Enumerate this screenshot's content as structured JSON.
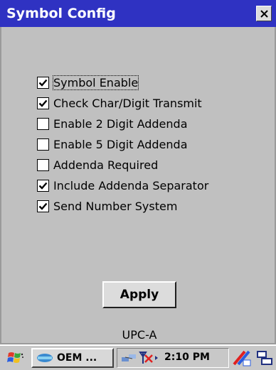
{
  "window": {
    "title": "Symbol Config",
    "close_label": "close"
  },
  "options": [
    {
      "label": "Symbol Enable",
      "checked": true,
      "focused": true
    },
    {
      "label": "Check Char/Digit Transmit",
      "checked": true,
      "focused": false
    },
    {
      "label": "Enable 2 Digit Addenda",
      "checked": false,
      "focused": false
    },
    {
      "label": "Enable 5 Digit Addenda",
      "checked": false,
      "focused": false
    },
    {
      "label": "Addenda Required",
      "checked": false,
      "focused": false
    },
    {
      "label": "Include Addenda Separator",
      "checked": true,
      "focused": false
    },
    {
      "label": "Send Number System",
      "checked": true,
      "focused": false
    }
  ],
  "apply_label": "Apply",
  "symbology_name": "UPC-A",
  "taskbar": {
    "task_label": "OEM ...",
    "clock": "2:10 PM"
  },
  "colors": {
    "titlebar": "#2f32c2",
    "window_bg": "#c0c0c0"
  },
  "icons": {
    "start": "windows-flag-icon",
    "task": "oem-app-icon",
    "network": "network-connection-icon",
    "signal": "no-signal-icon",
    "input": "input-panel-icon",
    "keyboard": "keyboard-icon"
  }
}
